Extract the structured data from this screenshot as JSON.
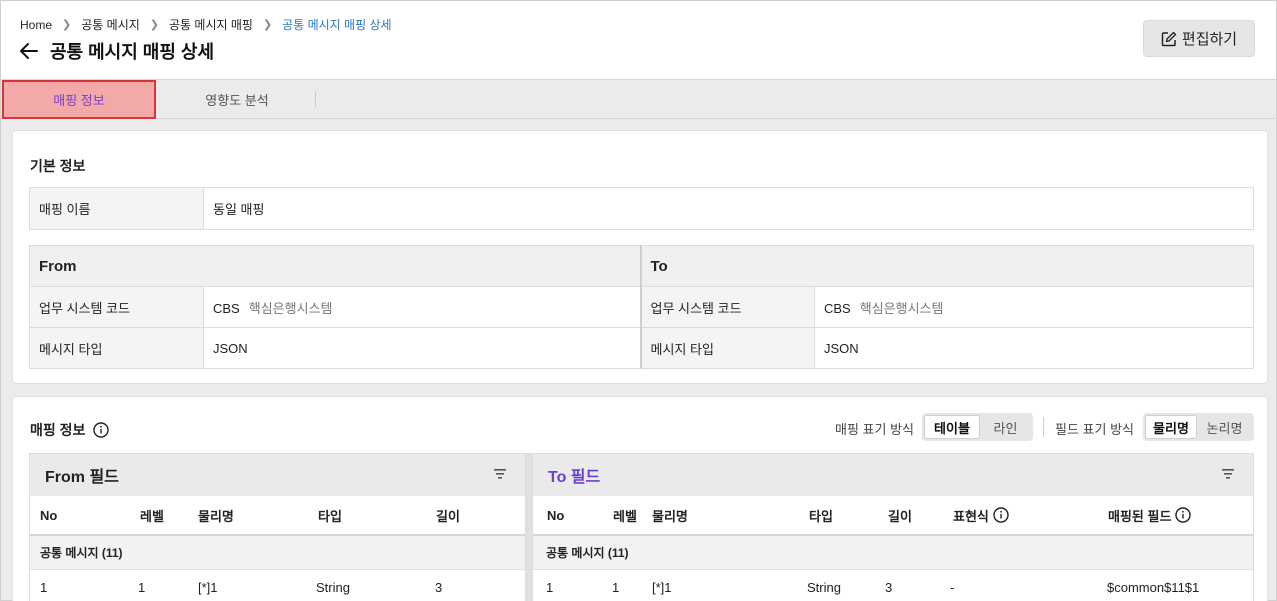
{
  "breadcrumb": {
    "items": [
      "Home",
      "공통 메시지",
      "공통 메시지 매핑"
    ],
    "current": "공통 메시지 매핑 상세"
  },
  "header": {
    "title": "공통 메시지 매핑 상세",
    "edit_label": "편집하기"
  },
  "tabs": [
    {
      "label": "매핑 정보",
      "active": true
    },
    {
      "label": "영향도 분석",
      "active": false
    }
  ],
  "basic_info": {
    "title": "기본 정보",
    "mapping_name_label": "매핑 이름",
    "mapping_name_value": "동일 매핑",
    "from": {
      "header": "From",
      "system_code_label": "업무 시스템 코드",
      "system_code": "CBS",
      "system_name": "핵심은행시스템",
      "message_type_label": "메시지 타입",
      "message_type": "JSON"
    },
    "to": {
      "header": "To",
      "system_code_label": "업무 시스템 코드",
      "system_code": "CBS",
      "system_name": "핵심은행시스템",
      "message_type_label": "메시지 타입",
      "message_type": "JSON"
    }
  },
  "mapping_info": {
    "title": "매핑 정보",
    "display_mode_label": "매핑 표기 방식",
    "display_modes": [
      "테이블",
      "라인"
    ],
    "display_mode_selected": "테이블",
    "field_mode_label": "필드 표기 방식",
    "field_modes": [
      "물리명",
      "논리명"
    ],
    "field_mode_selected": "물리명",
    "from_panel": {
      "title": "From 필드",
      "columns": [
        "No",
        "레벨",
        "물리명",
        "타입",
        "길이"
      ],
      "group": "공통 메시지 (11)",
      "rows": [
        {
          "no": "1",
          "level": "1",
          "name": "[*]1",
          "type": "String",
          "length": "3"
        }
      ]
    },
    "to_panel": {
      "title": "To 필드",
      "columns": [
        "No",
        "레벨",
        "물리명",
        "타입",
        "길이",
        "표현식",
        "매핑된 필드"
      ],
      "group": "공통 메시지 (11)",
      "rows": [
        {
          "no": "1",
          "level": "1",
          "name": "[*]1",
          "type": "String",
          "length": "3",
          "expr": "-",
          "mapped": "$common$11$1"
        }
      ]
    }
  },
  "colors": {
    "accent_purple": "#6a3fd0",
    "breadcrumb_current": "#2a78c5",
    "active_tab_bg": "#f4a9a9",
    "active_tab_border": "#d9343b"
  }
}
